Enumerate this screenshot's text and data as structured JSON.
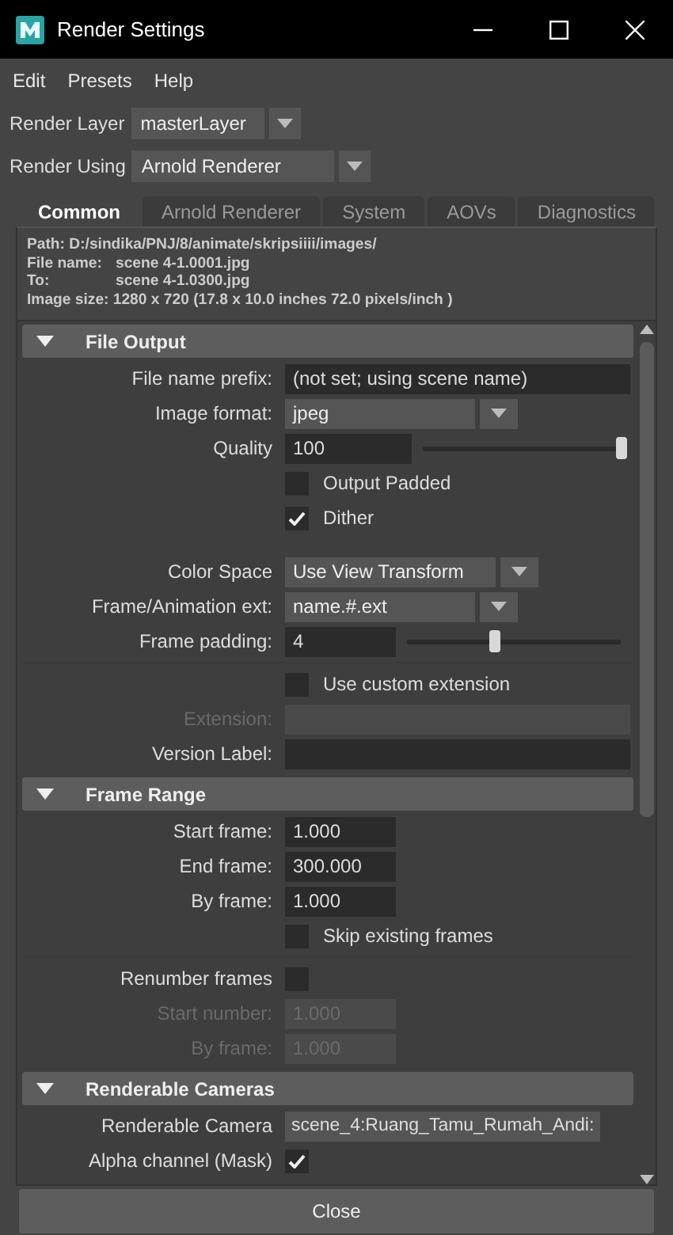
{
  "window": {
    "title": "Render Settings"
  },
  "menu": [
    "Edit",
    "Presets",
    "Help"
  ],
  "render_layer": {
    "label": "Render Layer",
    "value": "masterLayer"
  },
  "render_using": {
    "label": "Render Using",
    "value": "Arnold Renderer"
  },
  "tabs": [
    {
      "label": "Common",
      "selected": true
    },
    {
      "label": "Arnold Renderer",
      "selected": false
    },
    {
      "label": "System",
      "selected": false
    },
    {
      "label": "AOVs",
      "selected": false
    },
    {
      "label": "Diagnostics",
      "selected": false
    }
  ],
  "info": [
    {
      "kind": "text",
      "text": "Path: D:/sindika/PNJ/8/animate/skripsiiii/images/"
    },
    {
      "kind": "pair",
      "label": "File name:",
      "value": "scene 4-1.0001.jpg"
    },
    {
      "kind": "pair",
      "label": "To:",
      "value": "scene 4-1.0300.jpg"
    },
    {
      "kind": "text",
      "text": "Image size: 1280 x 720 (17.8 x 10.0 inches 72.0 pixels/inch )"
    }
  ],
  "sections": [
    {
      "title": "File Output",
      "expanded": true,
      "rows": [
        {
          "kind": "field",
          "label": "File name prefix:",
          "value": "(not set; using scene name)",
          "disabled": false
        },
        {
          "kind": "dropdown",
          "label": "Image format:",
          "value": "jpeg",
          "disabled": false
        },
        {
          "kind": "slider",
          "label": "Quality",
          "value": "100",
          "level": 1.0,
          "disabled": false
        },
        {
          "kind": "checkbox",
          "text": "Output Padded",
          "checked": false,
          "disabled": false
        },
        {
          "kind": "checkbox",
          "text": "Dither",
          "checked": true,
          "disabled": false
        },
        {
          "kind": "gap"
        },
        {
          "kind": "dropdown",
          "label": "Color Space",
          "value": "Use View Transform",
          "disabled": false
        },
        {
          "kind": "dropdown",
          "label": "Frame/Animation ext:",
          "value": "name.#.ext",
          "disabled": false
        },
        {
          "kind": "slider",
          "label": "Frame padding:",
          "value": "4",
          "level": 0.41,
          "disabled": false
        },
        {
          "kind": "divider"
        },
        {
          "kind": "checkbox",
          "text": "Use custom extension",
          "checked": false,
          "disabled": false
        },
        {
          "kind": "field",
          "label": "Extension:",
          "disabled": true
        },
        {
          "kind": "field",
          "label": "Version Label:",
          "disabled": false
        }
      ]
    },
    {
      "title": "Frame Range",
      "expanded": true,
      "rows": [
        {
          "kind": "number",
          "label": "Start frame:",
          "value": "1.000",
          "disabled": false
        },
        {
          "kind": "number",
          "label": "End frame:",
          "value": "300.000",
          "disabled": false
        },
        {
          "kind": "number",
          "label": "By frame:",
          "value": "1.000",
          "disabled": false
        },
        {
          "kind": "checkbox",
          "text": "Skip existing frames",
          "checked": false,
          "disabled": false
        },
        {
          "kind": "divider"
        },
        {
          "kind": "checkbox",
          "label": "Renumber frames",
          "checked": false,
          "disabled": false
        },
        {
          "kind": "number",
          "label": "Start number:",
          "value": "1.000",
          "disabled": true
        },
        {
          "kind": "number",
          "label": "By frame:",
          "value": "1.000",
          "disabled": true
        }
      ]
    },
    {
      "title": "Renderable Cameras",
      "expanded": true,
      "rows": [
        {
          "kind": "combo",
          "label": "Renderable Camera",
          "value": "scene_4:Ruang_Tamu_Rumah_Andi:",
          "disabled": false
        },
        {
          "kind": "checkbox",
          "label": "Alpha channel (Mask)",
          "checked": true,
          "disabled": false
        }
      ]
    }
  ],
  "close_button": "Close"
}
